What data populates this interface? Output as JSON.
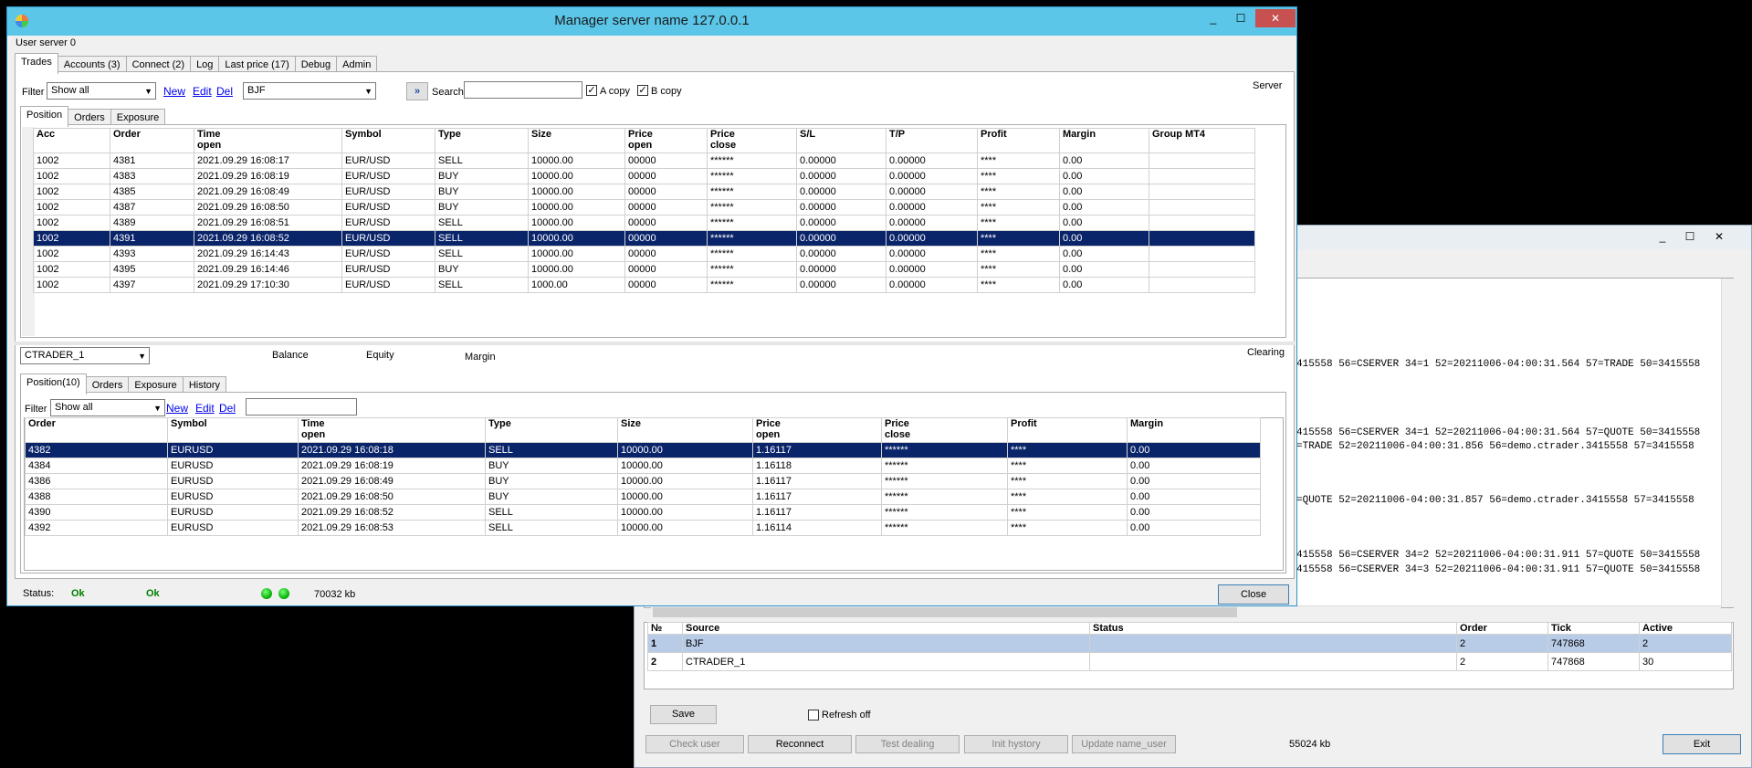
{
  "main": {
    "title": "Manager server name 127.0.0.1",
    "user_server": "User server 0",
    "controls": [
      "_",
      "☐",
      "✕"
    ],
    "tabs": [
      "Trades",
      "Accounts (3)",
      "Connect (2)",
      "Log",
      "Last price (17)",
      "Debug",
      "Admin"
    ],
    "filter_label": "Filter",
    "filter_value": "Show all",
    "link_new": "New",
    "link_edit": "Edit",
    "link_del": "Del",
    "source_value": "BJF",
    "search_label": "Search",
    "a_copy": "A copy",
    "b_copy": "B copy",
    "server_label": "Server",
    "top_subtabs": [
      "Position",
      "Orders",
      "Exposure"
    ],
    "top_headers": [
      [
        "Acc",
        ""
      ],
      [
        "Order",
        ""
      ],
      [
        "Time",
        "open"
      ],
      [
        "Symbol",
        ""
      ],
      [
        "Type",
        ""
      ],
      [
        "Size",
        ""
      ],
      [
        "Price",
        "open"
      ],
      [
        "Price",
        "close"
      ],
      [
        "S/L",
        ""
      ],
      [
        "T/P",
        ""
      ],
      [
        "Profit",
        ""
      ],
      [
        "Margin",
        ""
      ],
      [
        "Group MT4",
        ""
      ]
    ],
    "top_rows": [
      [
        "1002",
        "4381",
        "2021.09.29 16:08:17",
        "EUR/USD",
        "SELL",
        "10000.00",
        "00000",
        "******",
        "0.00000",
        "0.00000",
        "****",
        "0.00",
        ""
      ],
      [
        "1002",
        "4383",
        "2021.09.29 16:08:19",
        "EUR/USD",
        "BUY",
        "10000.00",
        "00000",
        "******",
        "0.00000",
        "0.00000",
        "****",
        "0.00",
        ""
      ],
      [
        "1002",
        "4385",
        "2021.09.29 16:08:49",
        "EUR/USD",
        "BUY",
        "10000.00",
        "00000",
        "******",
        "0.00000",
        "0.00000",
        "****",
        "0.00",
        ""
      ],
      [
        "1002",
        "4387",
        "2021.09.29 16:08:50",
        "EUR/USD",
        "BUY",
        "10000.00",
        "00000",
        "******",
        "0.00000",
        "0.00000",
        "****",
        "0.00",
        ""
      ],
      [
        "1002",
        "4389",
        "2021.09.29 16:08:51",
        "EUR/USD",
        "SELL",
        "10000.00",
        "00000",
        "******",
        "0.00000",
        "0.00000",
        "****",
        "0.00",
        ""
      ],
      [
        "1002",
        "4391",
        "2021.09.29 16:08:52",
        "EUR/USD",
        "SELL",
        "10000.00",
        "00000",
        "******",
        "0.00000",
        "0.00000",
        "****",
        "0.00",
        ""
      ],
      [
        "1002",
        "4393",
        "2021.09.29 16:14:43",
        "EUR/USD",
        "SELL",
        "10000.00",
        "00000",
        "******",
        "0.00000",
        "0.00000",
        "****",
        "0.00",
        ""
      ],
      [
        "1002",
        "4395",
        "2021.09.29 16:14:46",
        "EUR/USD",
        "BUY",
        "10000.00",
        "00000",
        "******",
        "0.00000",
        "0.00000",
        "****",
        "0.00",
        ""
      ],
      [
        "1002",
        "4397",
        "2021.09.29 17:10:30",
        "EUR/USD",
        "SELL",
        "1000.00",
        "00000",
        "******",
        "0.00000",
        "0.00000",
        "****",
        "0.00",
        ""
      ]
    ],
    "top_selected": 5,
    "account_value": "CTRADER_1",
    "balance_label": "Balance",
    "equity_label": "Equity",
    "margin_label": "Margin",
    "clearing_label": "Clearing",
    "bottom_subtabs": [
      "Position(10)",
      "Orders",
      "Exposure",
      "History"
    ],
    "bottom_headers": [
      [
        "Order",
        ""
      ],
      [
        "Symbol",
        ""
      ],
      [
        "Time",
        "open"
      ],
      [
        "Type",
        ""
      ],
      [
        "Size",
        ""
      ],
      [
        "Price",
        "open"
      ],
      [
        "Price",
        "close"
      ],
      [
        "Profit",
        ""
      ],
      [
        "Margin",
        ""
      ]
    ],
    "bottom_rows": [
      [
        "4382",
        "EURUSD",
        "2021.09.29 16:08:18",
        "SELL",
        "10000.00",
        "1.16117",
        "******",
        "****",
        "0.00"
      ],
      [
        "4384",
        "EURUSD",
        "2021.09.29 16:08:19",
        "BUY",
        "10000.00",
        "1.16118",
        "******",
        "****",
        "0.00"
      ],
      [
        "4386",
        "EURUSD",
        "2021.09.29 16:08:49",
        "BUY",
        "10000.00",
        "1.16117",
        "******",
        "****",
        "0.00"
      ],
      [
        "4388",
        "EURUSD",
        "2021.09.29 16:08:50",
        "BUY",
        "10000.00",
        "1.16117",
        "******",
        "****",
        "0.00"
      ],
      [
        "4390",
        "EURUSD",
        "2021.09.29 16:08:52",
        "SELL",
        "10000.00",
        "1.16117",
        "******",
        "****",
        "0.00"
      ],
      [
        "4392",
        "EURUSD",
        "2021.09.29 16:08:53",
        "SELL",
        "10000.00",
        "1.16114",
        "******",
        "****",
        "0.00"
      ]
    ],
    "bottom_selected": 0,
    "status_label": "Status:",
    "status_ok1": "Ok",
    "status_ok2": "Ok",
    "memory": "70032 kb",
    "close_button": "Close"
  },
  "secondary": {
    "log_lines": [
      "415558 56=CSERVER 34=1 52=20211006-04:00:31.564 57=TRADE 50=3415558",
      "415558 56=CSERVER 34=1 52=20211006-04:00:31.564 57=QUOTE 50=3415558",
      "=TRADE 52=20211006-04:00:31.856 56=demo.ctrader.3415558 57=3415558",
      "=QUOTE 52=20211006-04:00:31.857 56=demo.ctrader.3415558 57=3415558",
      "415558 56=CSERVER 34=2 52=20211006-04:00:31.911 57=QUOTE 50=3415558",
      "415558 56=CSERVER 34=3 52=20211006-04:00:31.911 57=QUOTE 50=3415558"
    ],
    "src_headers": [
      "№",
      "Source",
      "Status",
      "Order",
      "Tick",
      "Active"
    ],
    "src_rows": [
      [
        "1",
        "BJF",
        "",
        "2",
        "747868",
        "2"
      ],
      [
        "2",
        "CTRADER_1",
        "",
        "2",
        "747868",
        "30"
      ]
    ],
    "save_button": "Save",
    "refresh_off": "Refresh off",
    "check_user": "Check user",
    "reconnect": "Reconnect",
    "test_dealing": "Test dealing",
    "init_history": "Init hystory",
    "update_name_user": "Update  name_user",
    "memory": "55024 kb",
    "exit_button": "Exit"
  }
}
